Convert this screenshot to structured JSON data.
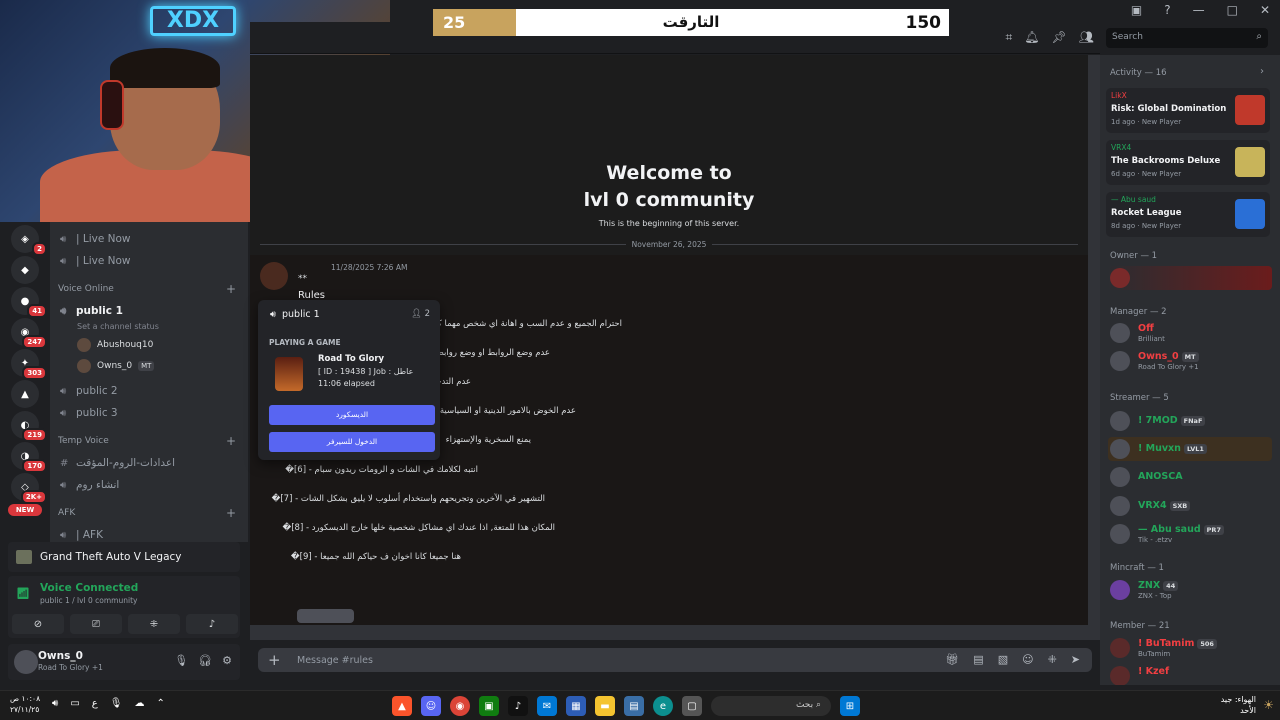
{
  "score_bar": {
    "left_value": "25",
    "title": "التارقت",
    "right_value": "150",
    "progress": 0.16
  },
  "window": {
    "title": "lvl 0 community"
  },
  "search": {
    "placeholder": "Search"
  },
  "channels": {
    "live_now": [
      "| Live Now",
      "| Live Now"
    ],
    "voice_online_label": "Voice Online",
    "public1": "public 1",
    "status_placeholder": "Set a channel status",
    "voice_users": [
      {
        "name": "Abushouq10",
        "tag": ""
      },
      {
        "name": "Owns_0",
        "tag": "MT"
      }
    ],
    "public2": "public 2",
    "public3": "public 3",
    "temp_voice_label": "Temp Voice",
    "temp_items": [
      "اعدادات-الروم-المؤقت",
      "انشاء روم"
    ],
    "afk_label": "AFK",
    "afk_item": "| AFK"
  },
  "rail": {
    "badges": [
      "2",
      "41",
      "247",
      "303",
      "219",
      "170",
      "2K+"
    ],
    "new_label": "NEW"
  },
  "game_panel": {
    "title": "Grand Theft Auto V Legacy"
  },
  "voice_panel": {
    "status": "Voice Connected",
    "sub": "public 1 / lvl 0 community"
  },
  "user_panel": {
    "name": "Owns_0",
    "activity": "Road To Glory +1"
  },
  "welcome": {
    "line1": "Welcome to",
    "line2": "lvl 0 community",
    "sub": "This is the beginning of this server."
  },
  "divider_date": "November 26, 2025",
  "message": {
    "time": "11/28/2025 7:26 AM",
    "stars": "**",
    "heading": "Rules",
    "lines": [
      "احترام الجميع و عدم السب و اهانة اي شخص مهما كان",
      "عدم وضع الروابط او وضع روابط",
      "عدم التدخل في شؤ",
      "عدم الخوض بالامور الدينية او السياسية",
      "يمنع السخرية والإستهزاء",
      "انتبه لكلامك في الشات و الرومات ريدون سبام - [6]�",
      "التشهير في الآخرين وتجريحهم واستخدام أسلوب لا يليق بشكل الشات - [7]�",
      "المكان هذا للمتعة, اذا عندك اي مشاكل شخصية خلها خارج الديسكورد - [8]�",
      "هنا جميعا كانا اخوان ف حياكم الله جميعا - [9]�"
    ]
  },
  "popover": {
    "channel": "public 1",
    "count": "2",
    "label": "PLAYING A GAME",
    "game": "Road To Glory",
    "detail": "[ ID : 19438 ] Job : عاطل",
    "elapsed": "11:06 elapsed",
    "btn1": "الديسكورد",
    "btn2": "الدخول للسيرفر"
  },
  "composer": {
    "placeholder": "Message #rules"
  },
  "members": {
    "activity_header": "Activity — 16",
    "activities": [
      {
        "user": "LikX",
        "game": "Risk: Global Domination",
        "meta": "1d ago · New Player",
        "user_color": "#f23f42",
        "thumb": "#c0392b"
      },
      {
        "user": "VRX4",
        "game": "The Backrooms Deluxe",
        "meta": "6d ago · New Player",
        "user_color": "#23a55a",
        "thumb": "#c8b45a"
      },
      {
        "user": "— Abu saud",
        "game": "Rocket League",
        "meta": "8d ago · New Player",
        "user_color": "#23a55a",
        "thumb": "#2a6fd6"
      }
    ],
    "groups": [
      {
        "label": "Owner — 1"
      },
      {
        "label": "Manager — 2"
      },
      {
        "label": "Streamer — 5"
      },
      {
        "label": "Mincraft — 1"
      },
      {
        "label": "Member — 21"
      }
    ],
    "owner": [
      {
        "name": "",
        "sub": "",
        "color": "#f23f42",
        "tag": ""
      }
    ],
    "managers": [
      {
        "name": "Off",
        "sub": "Brilliant",
        "color": "#f23f42",
        "tag": ""
      },
      {
        "name": "Owns_0",
        "sub": "Road To Glory +1",
        "color": "#f23f42",
        "tag": "MT"
      }
    ],
    "streamers": [
      {
        "name": "! 7MOD",
        "sub": "",
        "color": "#23a55a",
        "tag": "FNaF"
      },
      {
        "name": "! Muvxn",
        "sub": "",
        "color": "#23a55a",
        "tag": "LVL1"
      },
      {
        "name": "ANOSCA",
        "sub": "",
        "color": "#23a55a",
        "tag": ""
      },
      {
        "name": "VRX4",
        "sub": "",
        "color": "#23a55a",
        "tag": "SXB"
      },
      {
        "name": "— Abu saud",
        "sub": "Tik - .etzv",
        "color": "#23a55a",
        "tag": "PR7"
      }
    ],
    "mincraft": [
      {
        "name": "ZNX",
        "sub": "ZNX - Top",
        "color": "#23a55a",
        "tag": "44"
      }
    ],
    "member": [
      {
        "name": "! BuTamim",
        "sub": "BuTamim",
        "color": "#f23f42",
        "tag": "506"
      },
      {
        "name": "! Kzef",
        "sub": "",
        "color": "#f23f42",
        "tag": ""
      }
    ]
  },
  "taskbar": {
    "clock_time": "١٠:٠٨ ص",
    "clock_date": "٢٧/١١/٢٥",
    "search": "بحث",
    "weather_line1": "الهواء: جيد",
    "weather_line2": "الأحد"
  }
}
